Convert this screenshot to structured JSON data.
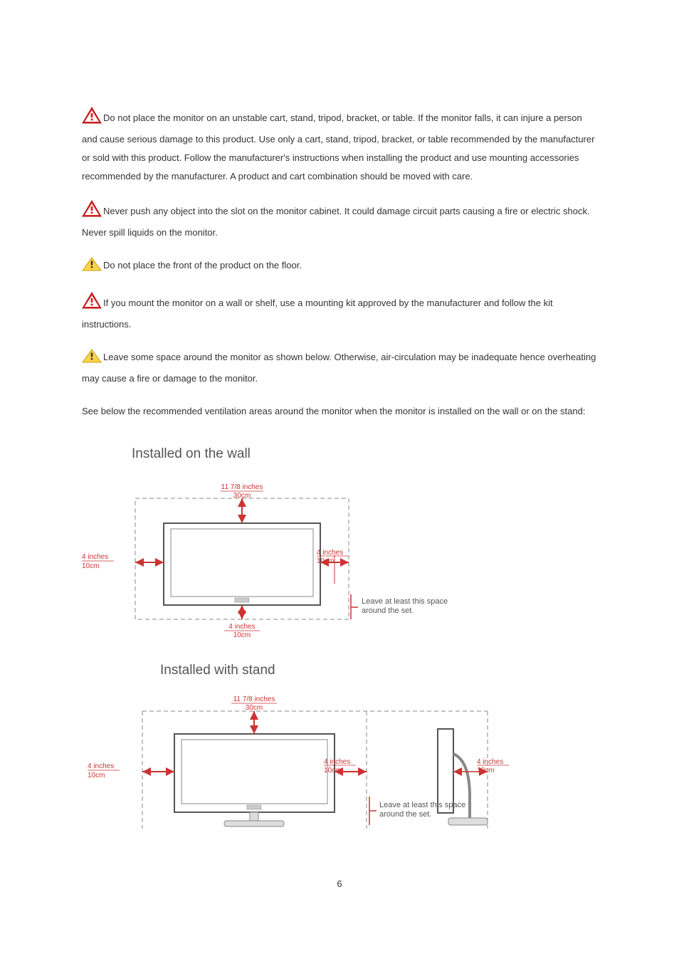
{
  "paragraphs": {
    "p1": "Do not place the monitor on an unstable cart, stand, tripod, bracket, or table. If the monitor falls, it can injure a person and cause serious damage to this product. Use only a cart, stand, tripod, bracket, or table recommended by the manufacturer or sold with this product. Follow the manufacturer's instructions when installing the product and use mounting accessories recommended by the manufacturer. A product and cart combination should be moved with care.",
    "p2": "Never push any object into the slot on the monitor cabinet. It could damage circuit parts causing a fire or electric shock. Never spill liquids on the monitor.",
    "p3": "Do not place the front of the product on the floor.",
    "p4": "If you mount the monitor on a wall or shelf, use a mounting kit approved by the manufacturer and follow the kit instructions.",
    "p5": "Leave some space around the monitor as shown below. Otherwise, air-circulation may be inadequate hence overheating may cause a fire or damage to the monitor.",
    "p6": "See below the recommended ventilation areas around the monitor when the monitor is installed on the wall or on the stand:"
  },
  "diagram_wall": {
    "title": "Installed on the wall",
    "top_in": "11 7/8 inches",
    "top_cm": "30cm",
    "left_in": "4 inches",
    "left_cm": "10cm",
    "right_in": "4 inches",
    "right_cm": "10cm",
    "bottom_in": "4 inches",
    "bottom_cm": "10cm",
    "note_l1": "Leave at least this space",
    "note_l2": "around the set."
  },
  "diagram_stand": {
    "title": "Installed with stand",
    "top_in": "11 7/8 inches",
    "top_cm": "30cm",
    "left_in": "4 inches",
    "left_cm": "10cm",
    "mid_in": "4 inches",
    "mid_cm": "10cm",
    "right_in": "4 inches",
    "right_cm": "10cm",
    "note_l1": "Leave at least this space",
    "note_l2": "around the set."
  },
  "page_number": "6"
}
